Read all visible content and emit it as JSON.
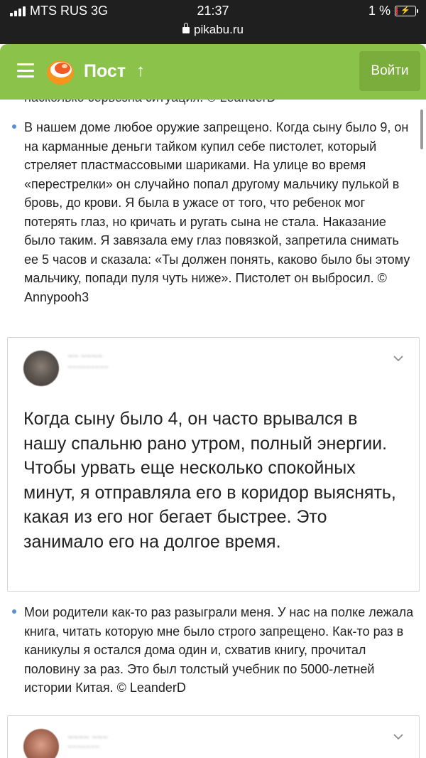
{
  "status_bar": {
    "carrier": "MTS RUS 3G",
    "time": "21:37",
    "battery_percent": "1 %",
    "battery_level": 0.01,
    "url": "pikabu.ru"
  },
  "header": {
    "title": "Пост",
    "login_label": "Войти",
    "accent_color": "#8bc34a"
  },
  "content": {
    "cut_line": "насколько серьезна ситуация. © LeanderD",
    "bullet_1": "В нашем доме любое оружие запрещено. Когда сыну было 9, он на карманные деньги тайком купил себе пистолет, который стреляет пластмассовыми шариками. На улице во время «перестрелки» он случайно попал другому мальчику пулькой в бровь, до крови. Я была в ужасе от того, что ребенок мог потерять глаз, но кричать и ругать сына не стала. Наказание было таким. Я завязала ему глаз повязкой, запретила снимать ее 5 часов и сказала: «Ты должен понять, каково было бы этому мальчику, попади пуля чуть ниже». Пистолет он выбросил. © Annypooh3",
    "card_1": {
      "text": "Когда сыну было 4, он часто врывался в нашу спальню рано утром, полный энергии. Чтобы урвать еще несколько спокойных минут, я отправляла его в коридор выяснять, какая из его ног бегает быстрее. Это занимало его на долгое время."
    },
    "bullet_2": "Мои родители как-то раз разыграли меня. У нас на полке лежала книга, читать которую мне было строго запрещено. Как-то раз в каникулы я остался дома один и, схватив книгу, прочитал половину за раз. Это был толстый учебник по 5000-летней истории Китая. © LeanderD"
  }
}
